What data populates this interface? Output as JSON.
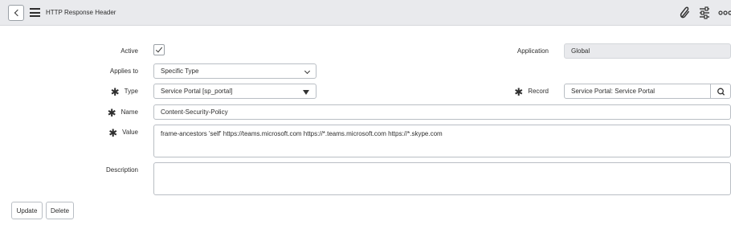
{
  "header": {
    "title": "HTTP Response Header",
    "icons": [
      "back-icon",
      "menu-icon",
      "paperclip-icon",
      "settings-sliders-icon",
      "more-icon"
    ]
  },
  "form": {
    "active": {
      "label": "Active",
      "checked": true
    },
    "application": {
      "label": "Application",
      "value": "Global"
    },
    "applies_to": {
      "label": "Applies to",
      "value": "Specific Type"
    },
    "type": {
      "label": "Type",
      "value": "Service Portal [sp_portal]"
    },
    "record": {
      "label": "Record",
      "value": "Service Portal: Service Portal"
    },
    "name": {
      "label": "Name",
      "value": "Content-Security-Policy"
    },
    "value": {
      "label": "Value",
      "value": "frame-ancestors 'self' https://teams.microsoft.com https://*.teams.microsoft.com https://*.skype.com"
    },
    "description": {
      "label": "Description",
      "value": ""
    }
  },
  "actions": {
    "update_label": "Update",
    "delete_label": "Delete"
  }
}
